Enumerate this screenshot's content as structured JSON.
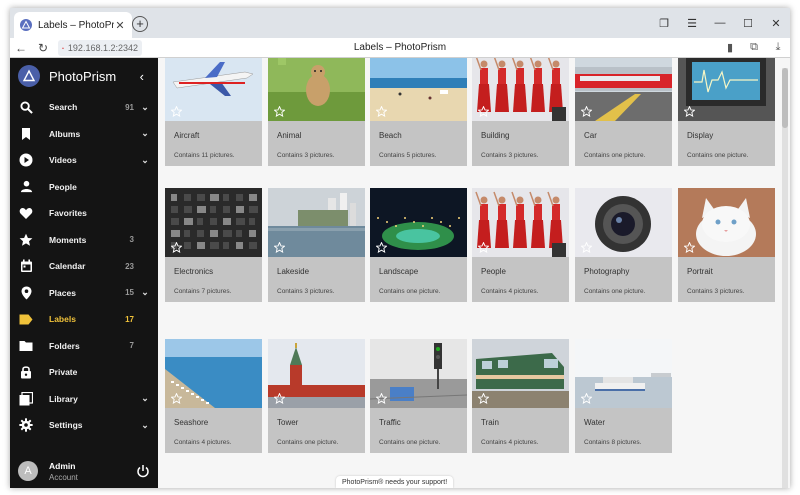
{
  "browser": {
    "tab_title": "Labels – PhotoPrism",
    "url": "192.168.1.2:2342",
    "page_title": "Labels – PhotoPrism"
  },
  "sidebar": {
    "brand": "PhotoPrism",
    "items": [
      {
        "label": "Search",
        "count": "91",
        "chevron": true,
        "icon": "search-icon",
        "active": false
      },
      {
        "label": "Albums",
        "count": "",
        "chevron": true,
        "icon": "bookmark-icon",
        "active": false
      },
      {
        "label": "Videos",
        "count": "",
        "chevron": true,
        "icon": "play-icon",
        "active": false
      },
      {
        "label": "People",
        "count": "",
        "chevron": false,
        "icon": "person-icon",
        "active": false
      },
      {
        "label": "Favorites",
        "count": "",
        "chevron": false,
        "icon": "heart-icon",
        "active": false
      },
      {
        "label": "Moments",
        "count": "3",
        "chevron": false,
        "icon": "star-icon",
        "active": false
      },
      {
        "label": "Calendar",
        "count": "23",
        "chevron": false,
        "icon": "calendar-icon",
        "active": false
      },
      {
        "label": "Places",
        "count": "15",
        "chevron": true,
        "icon": "location-pin-icon",
        "active": false
      },
      {
        "label": "Labels",
        "count": "17",
        "chevron": false,
        "icon": "label-icon",
        "active": true
      },
      {
        "label": "Folders",
        "count": "7",
        "chevron": false,
        "icon": "folder-icon",
        "active": false
      },
      {
        "label": "Private",
        "count": "",
        "chevron": false,
        "icon": "lock-icon",
        "active": false
      },
      {
        "label": "Library",
        "count": "",
        "chevron": true,
        "icon": "library-icon",
        "active": false
      },
      {
        "label": "Settings",
        "count": "",
        "chevron": true,
        "icon": "gear-icon",
        "active": false
      }
    ],
    "account": {
      "avatar_letter": "A",
      "name": "Admin",
      "subtitle": "Account"
    }
  },
  "labels": [
    {
      "title": "Aircraft",
      "subtitle": "Contains 11 pictures.",
      "scene": "aircraft"
    },
    {
      "title": "Animal",
      "subtitle": "Contains 3 pictures.",
      "scene": "animal"
    },
    {
      "title": "Beach",
      "subtitle": "Contains 5 pictures.",
      "scene": "beach"
    },
    {
      "title": "Building",
      "subtitle": "Contains 3 pictures.",
      "scene": "dancers"
    },
    {
      "title": "Car",
      "subtitle": "Contains one picture.",
      "scene": "car"
    },
    {
      "title": "Display",
      "subtitle": "Contains one picture.",
      "scene": "display"
    },
    {
      "title": "Electronics",
      "subtitle": "Contains 7 pictures.",
      "scene": "electronics"
    },
    {
      "title": "Lakeside",
      "subtitle": "Contains 3 pictures.",
      "scene": "lakeside"
    },
    {
      "title": "Landscape",
      "subtitle": "Contains one picture.",
      "scene": "landscape"
    },
    {
      "title": "People",
      "subtitle": "Contains 4 pictures.",
      "scene": "dancers"
    },
    {
      "title": "Photography",
      "subtitle": "Contains one picture.",
      "scene": "lens"
    },
    {
      "title": "Portrait",
      "subtitle": "Contains 3 pictures.",
      "scene": "cat"
    },
    {
      "title": "Seashore",
      "subtitle": "Contains 4 pictures.",
      "scene": "seashore"
    },
    {
      "title": "Tower",
      "subtitle": "Contains one picture.",
      "scene": "tower"
    },
    {
      "title": "Traffic",
      "subtitle": "Contains one picture.",
      "scene": "traffic"
    },
    {
      "title": "Train",
      "subtitle": "Contains 4 pictures.",
      "scene": "train"
    },
    {
      "title": "Water",
      "subtitle": "Contains 8 pictures.",
      "scene": "water"
    }
  ],
  "footer": {
    "support_text": "PhotoPrism® needs your support!"
  },
  "colors": {
    "sidebar_bg": "#141414",
    "accent": "#f0c23a",
    "card_bg": "#c4c4c4"
  }
}
